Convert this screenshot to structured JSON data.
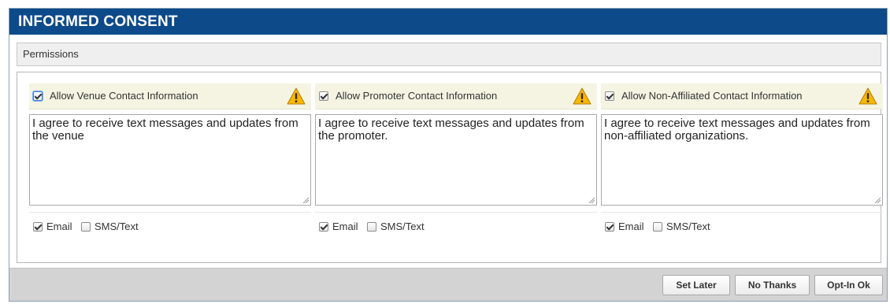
{
  "dialog": {
    "title": "INFORMED CONSENT",
    "section_label": "Permissions"
  },
  "columns": [
    {
      "header_label": "Allow Venue Contact Information",
      "header_checked": true,
      "message": "I agree to receive text messages and updates from the venue",
      "email_label": "Email",
      "email_checked": true,
      "sms_label": "SMS/Text",
      "sms_checked": false
    },
    {
      "header_label": "Allow Promoter Contact Information",
      "header_checked": true,
      "message": "I agree to receive text messages and updates from the promoter.",
      "email_label": "Email",
      "email_checked": true,
      "sms_label": "SMS/Text",
      "sms_checked": false
    },
    {
      "header_label": "Allow Non-Affiliated Contact Information",
      "header_checked": true,
      "message": "I agree to receive text messages and updates from non-affiliated organizations.",
      "email_label": "Email",
      "email_checked": true,
      "sms_label": "SMS/Text",
      "sms_checked": false
    }
  ],
  "footer": {
    "set_later_label": "Set Later",
    "no_thanks_label": "No Thanks",
    "opt_in_label": "Opt-In Ok"
  },
  "colors": {
    "title_bar": "#0d4a8a",
    "header_bg": "#f5f4e2",
    "warning_yellow": "#f5b800",
    "footer_bg": "#d3d3d3"
  },
  "icons": {
    "warning": "warning-icon"
  }
}
